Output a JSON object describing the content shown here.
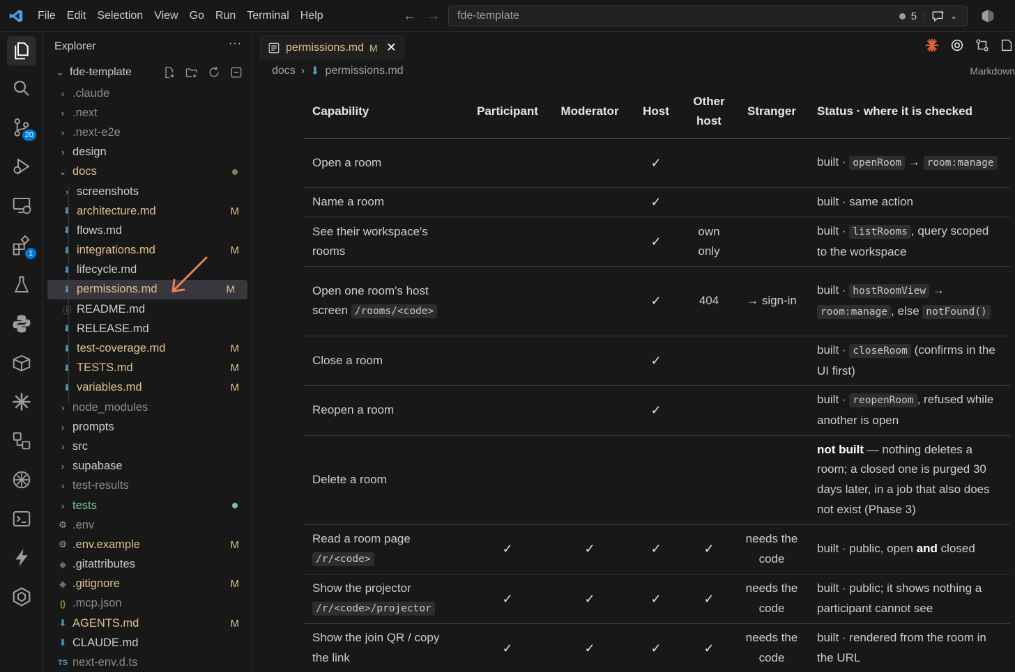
{
  "titlebar": {
    "menu": [
      "File",
      "Edit",
      "Selection",
      "View",
      "Go",
      "Run",
      "Terminal",
      "Help"
    ],
    "search_text": "fde-template",
    "notification_count": "5"
  },
  "activity": {
    "scm_badge": "20",
    "extensions_badge": "1"
  },
  "sidebar": {
    "title": "Explorer",
    "more": "···",
    "root": "fde-template",
    "items": [
      {
        "name": ".claude",
        "kind": "folder",
        "state": "collapsed",
        "status": "dim"
      },
      {
        "name": ".next",
        "kind": "folder",
        "state": "collapsed",
        "status": "dim"
      },
      {
        "name": ".next-e2e",
        "kind": "folder",
        "state": "collapsed",
        "status": "dim"
      },
      {
        "name": "design",
        "kind": "folder",
        "state": "collapsed",
        "status": "normal"
      },
      {
        "name": "docs",
        "kind": "folder",
        "state": "expanded",
        "status": "modified-dot"
      },
      {
        "name": "screenshots",
        "kind": "folder",
        "state": "collapsed",
        "status": "normal"
      },
      {
        "name": "architecture.md",
        "kind": "md",
        "status": "M"
      },
      {
        "name": "flows.md",
        "kind": "md",
        "status": "normal"
      },
      {
        "name": "integrations.md",
        "kind": "md",
        "status": "M"
      },
      {
        "name": "lifecycle.md",
        "kind": "md",
        "status": "normal"
      },
      {
        "name": "permissions.md",
        "kind": "md",
        "status": "M"
      },
      {
        "name": "README.md",
        "kind": "info",
        "status": "normal"
      },
      {
        "name": "RELEASE.md",
        "kind": "md",
        "status": "normal"
      },
      {
        "name": "test-coverage.md",
        "kind": "md",
        "status": "M"
      },
      {
        "name": "TESTS.md",
        "kind": "md",
        "status": "M"
      },
      {
        "name": "variables.md",
        "kind": "md",
        "status": "M"
      },
      {
        "name": "node_modules",
        "kind": "folder",
        "state": "collapsed",
        "status": "dim"
      },
      {
        "name": "prompts",
        "kind": "folder",
        "state": "collapsed",
        "status": "normal"
      },
      {
        "name": "src",
        "kind": "folder",
        "state": "collapsed",
        "status": "normal"
      },
      {
        "name": "supabase",
        "kind": "folder",
        "state": "collapsed",
        "status": "normal"
      },
      {
        "name": "test-results",
        "kind": "folder",
        "state": "collapsed",
        "status": "dim"
      },
      {
        "name": "tests",
        "kind": "folder",
        "state": "collapsed",
        "status": "new-dot"
      },
      {
        "name": ".env",
        "kind": "gear",
        "status": "dim"
      },
      {
        "name": ".env.example",
        "kind": "gear",
        "status": "M"
      },
      {
        "name": ".gitattributes",
        "kind": "git",
        "status": "normal"
      },
      {
        "name": ".gitignore",
        "kind": "git",
        "status": "M"
      },
      {
        "name": ".mcp.json",
        "kind": "json",
        "status": "dim"
      },
      {
        "name": "AGENTS.md",
        "kind": "md",
        "status": "M"
      },
      {
        "name": "CLAUDE.md",
        "kind": "md",
        "status": "normal"
      },
      {
        "name": "next-env.d.ts",
        "kind": "ts",
        "status": "dim"
      }
    ]
  },
  "editor": {
    "tab_label": "permissions.md",
    "tab_status": "M",
    "breadcrumb": [
      "docs",
      "permissions.md"
    ],
    "breadcrumb_right": "Markdown",
    "table": {
      "headers": [
        "Capability",
        "Participant",
        "Moderator",
        "Host",
        "Other host",
        "Stranger",
        "Status · where it is checked"
      ],
      "rows": [
        {
          "cap": "Open a room",
          "p": "",
          "m": "",
          "h": "✓",
          "o": "",
          "s": "",
          "status_html": "built · <code>openRoom</code> → <code>room:manage</code>"
        },
        {
          "cap": "Name a room",
          "p": "",
          "m": "",
          "h": "✓",
          "o": "",
          "s": "",
          "status_html": "built · same action"
        },
        {
          "cap": "See their workspace's rooms",
          "p": "",
          "m": "",
          "h": "✓",
          "o": "own only",
          "s": "",
          "status_html": "built · <code>listRooms</code>, query scoped to the workspace"
        },
        {
          "cap": "Open one room's host screen",
          "cap_code": "/rooms/<code>",
          "p": "",
          "m": "",
          "h": "✓",
          "o": "404",
          "s": "→ sign-in",
          "status_html": "built · <code>hostRoomView</code> → <code>room:manage</code>, else <code>notFound()</code>"
        },
        {
          "cap": "Close a room",
          "p": "",
          "m": "",
          "h": "✓",
          "o": "",
          "s": "",
          "status_html": "built · <code>closeRoom</code> (confirms in the UI first)"
        },
        {
          "cap": "Reopen a room",
          "p": "",
          "m": "",
          "h": "✓",
          "o": "",
          "s": "",
          "status_html": "built · <code>reopenRoom</code>, refused while another is open"
        },
        {
          "cap": "Delete a room",
          "p": "",
          "m": "",
          "h": "",
          "o": "",
          "s": "",
          "status_html": "<b>not built</b> — nothing deletes a room; a closed one is purged 30 days later, in a job that also does not exist (Phase 3)"
        },
        {
          "cap": "Read a room page",
          "cap_code": "/r/<code>",
          "p": "✓",
          "m": "✓",
          "h": "✓",
          "o": "✓",
          "s": "needs the code",
          "status_html": "built · public, open <b>and</b> closed"
        },
        {
          "cap": "Show the projector",
          "cap_code": "/r/<code>/projector",
          "p": "✓",
          "m": "✓",
          "h": "✓",
          "o": "✓",
          "s": "needs the code",
          "status_html": "built · public; it shows nothing a participant cannot see"
        },
        {
          "cap": "Show the join QR / copy the link",
          "p": "✓",
          "m": "✓",
          "h": "✓",
          "o": "✓",
          "s": "needs the code",
          "status_html": "built · rendered from the room in the URL"
        }
      ]
    }
  },
  "colors": {
    "modified": "#e2c08d",
    "untracked": "#73c991",
    "accent": "#0078d4",
    "md_icon": "#519aba",
    "arrow": "#e8825b"
  }
}
